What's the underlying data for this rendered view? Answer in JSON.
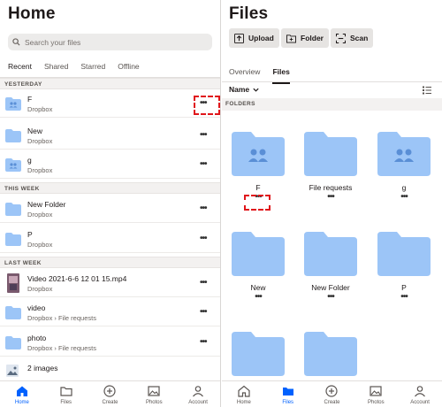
{
  "home": {
    "title": "Home",
    "search_placeholder": "Search your files",
    "tabs": [
      "Recent",
      "Shared",
      "Starred",
      "Offline"
    ],
    "sections": {
      "yesterday": "YESTERDAY",
      "this_week": "THIS WEEK",
      "last_week": "LAST WEEK"
    },
    "rows": [
      {
        "name": "F",
        "sub": "Dropbox",
        "icon": "shared-folder-icon"
      },
      {
        "name": "New",
        "sub": "Dropbox",
        "icon": "folder-icon"
      },
      {
        "name": "g",
        "sub": "Dropbox",
        "icon": "shared-folder-icon"
      },
      {
        "name": "New Folder",
        "sub": "Dropbox",
        "icon": "folder-icon"
      },
      {
        "name": "P",
        "sub": "Dropbox",
        "icon": "folder-icon"
      },
      {
        "name": "Video 2021-6-6 12 01 15.mp4",
        "sub": "Dropbox",
        "icon": "video-thumbnail"
      },
      {
        "name": "video",
        "sub": "Dropbox › File requests",
        "icon": "folder-icon"
      },
      {
        "name": "photo",
        "sub": "Dropbox › File requests",
        "icon": "folder-icon"
      },
      {
        "name": "2 images",
        "sub": "",
        "icon": "image-icon"
      }
    ],
    "more": "•••"
  },
  "files": {
    "title": "Files",
    "actions": {
      "upload": "Upload",
      "folder": "Folder",
      "scan": "Scan"
    },
    "tabs": [
      "Overview",
      "Files"
    ],
    "sort_label": "Name",
    "folders_header": "FOLDERS",
    "tiles": [
      {
        "name": "F",
        "shared": true
      },
      {
        "name": "File requests",
        "shared": false
      },
      {
        "name": "g",
        "shared": true
      },
      {
        "name": "New",
        "shared": false
      },
      {
        "name": "New Folder",
        "shared": false
      },
      {
        "name": "P",
        "shared": false
      },
      {
        "name": "",
        "shared": false
      },
      {
        "name": "",
        "shared": false
      }
    ],
    "more": "•••"
  },
  "nav": [
    "Home",
    "Files",
    "Create",
    "Photos",
    "Account"
  ],
  "colors": {
    "folder": "#9cc5f7",
    "folder_tab": "#b7d6fb",
    "accent": "#0061fe",
    "highlight": "#e0161b"
  }
}
